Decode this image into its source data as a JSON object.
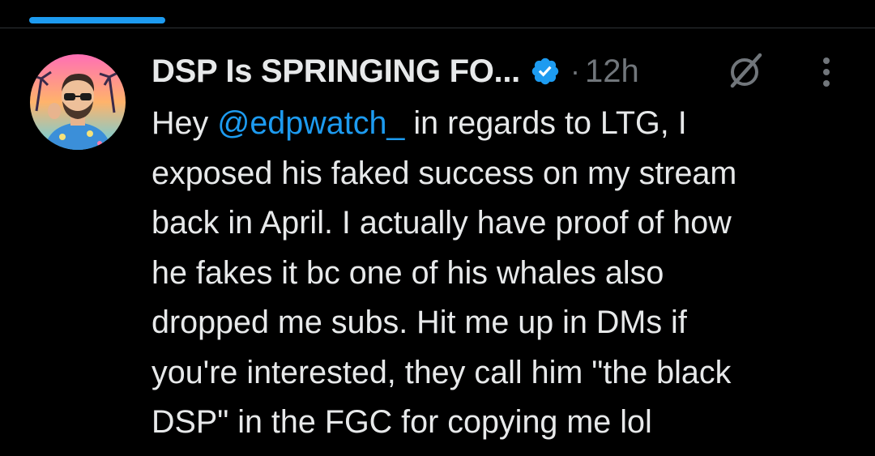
{
  "colors": {
    "background": "#000000",
    "text": "#e7e9ea",
    "muted": "#71767b",
    "accent": "#1d9bf0",
    "divider": "#2f3336"
  },
  "tweet": {
    "author_name": "DSP Is SPRINGING FO...",
    "verified_icon": "verified-badge-icon",
    "separator": "·",
    "timestamp": "12h",
    "grok_icon": "grok-slash-circle-icon",
    "more_icon": "vertical-dots-icon",
    "avatar_icon": "profile-avatar",
    "text_lines": [
      {
        "before": "Hey ",
        "mention": "@edpwatch_",
        "after": " in regards to LTG, I"
      },
      {
        "text": "exposed his faked success on my stream"
      },
      {
        "text": "back in April. I actually have proof of how"
      },
      {
        "text": "he fakes it bc one of his whales also"
      },
      {
        "text": "dropped me subs. Hit me up in DMs if"
      },
      {
        "text": "you're interested, they call him \"the black"
      },
      {
        "text": "DSP\" in the FGC for copying me lol"
      }
    ]
  }
}
